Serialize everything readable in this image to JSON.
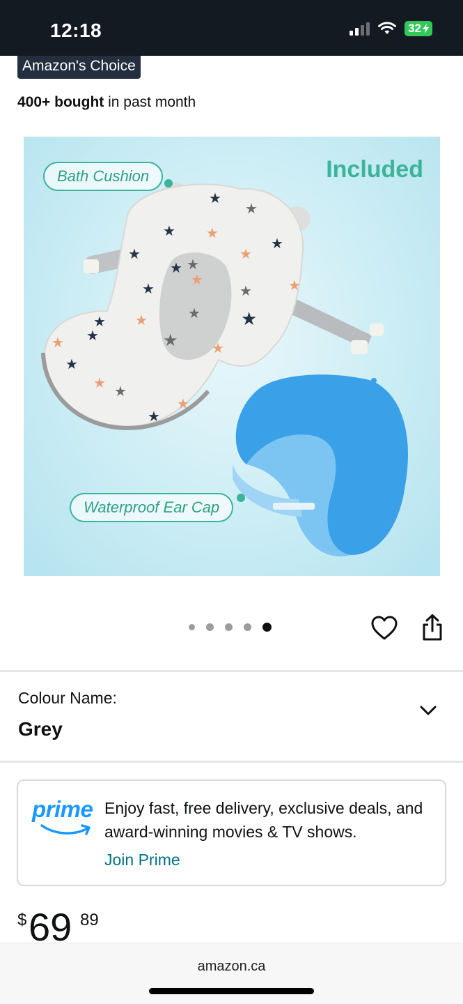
{
  "status_bar": {
    "time": "12:18",
    "battery": "32"
  },
  "product": {
    "badge": "Amazon's Choice",
    "bought_bold": "400+ bought",
    "bought_rest": " in past month",
    "image": {
      "callouts": [
        "Bath Cushion",
        "Waterproof Ear Cap"
      ],
      "included": "Included"
    },
    "carousel": {
      "count": 5,
      "active_index": 4
    }
  },
  "colour": {
    "label": "Colour Name:",
    "value": "Grey"
  },
  "prime": {
    "logo": "prime",
    "text": "Enjoy fast, free delivery, exclusive deals, and award-winning movies & TV shows.",
    "join": "Join Prime"
  },
  "price": {
    "symbol": "$",
    "whole": "69",
    "fraction": "89"
  },
  "browser": {
    "url": "amazon.ca"
  },
  "icons": {
    "wishlist": "heart-icon",
    "share": "share-icon",
    "dropdown": "chevron-down-icon",
    "prime_smile": "smile-arrow-icon"
  },
  "colors": {
    "status_bar_bg": "#131a22",
    "badge_bg": "#232f3e",
    "prime_blue": "#1a98ff",
    "link_teal": "#007185",
    "callout_green": "#3bb49a"
  }
}
